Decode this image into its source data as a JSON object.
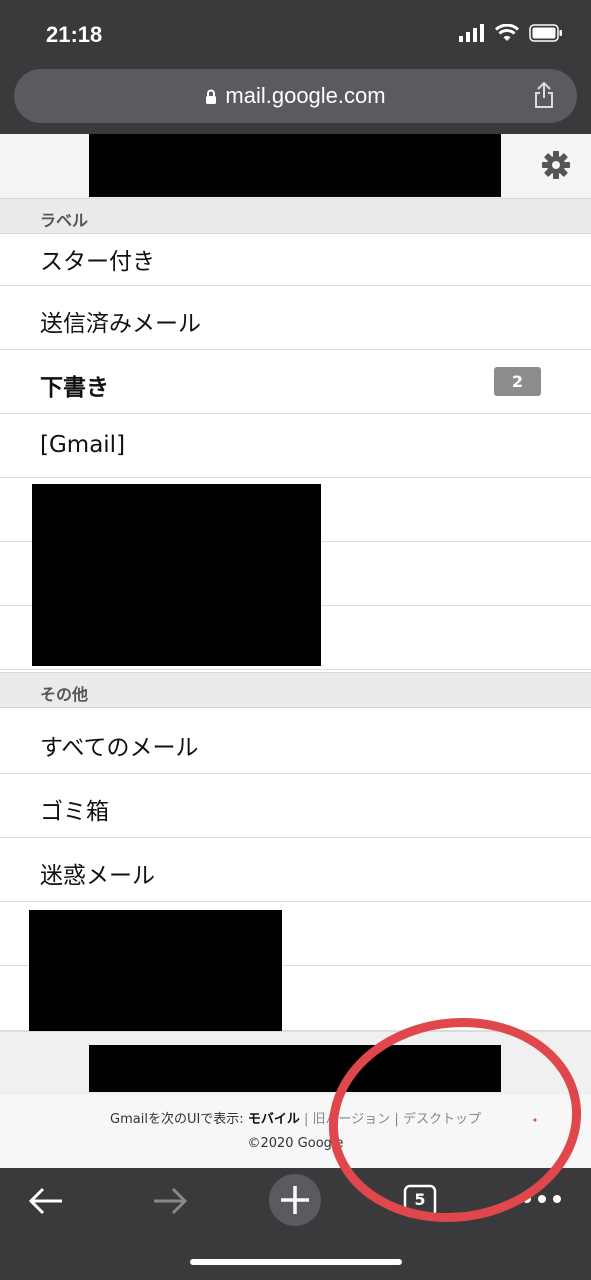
{
  "status_bar": {
    "time": "21:18"
  },
  "browser": {
    "url": "mail.google.com"
  },
  "sections": {
    "labels_header": "ラベル",
    "others_header": "その他"
  },
  "labels": [
    {
      "label": "スター付き"
    },
    {
      "label": "送信済みメール"
    },
    {
      "label": "下書き",
      "badge": "2"
    },
    {
      "label": "[Gmail]"
    }
  ],
  "others": [
    {
      "label": "すべてのメール"
    },
    {
      "label": "ゴミ箱"
    },
    {
      "label": "迷惑メール"
    }
  ],
  "footer": {
    "prefix": "Gmailを次のUIで表示:",
    "mobile": "モバイル",
    "sep": "|",
    "old_version": "旧バージョン",
    "desktop": "デスクトップ",
    "copyright": "©2020 Google"
  },
  "toolbar": {
    "tab_count": "5"
  },
  "colors": {
    "chrome": "#3a3a3c",
    "annotation": "#e0474c",
    "badge": "#8c8c8c"
  },
  "icons": [
    "lock-icon",
    "share-icon",
    "gear-icon",
    "back-icon",
    "forward-icon",
    "add-tab-icon",
    "tabs-icon",
    "more-icon"
  ]
}
